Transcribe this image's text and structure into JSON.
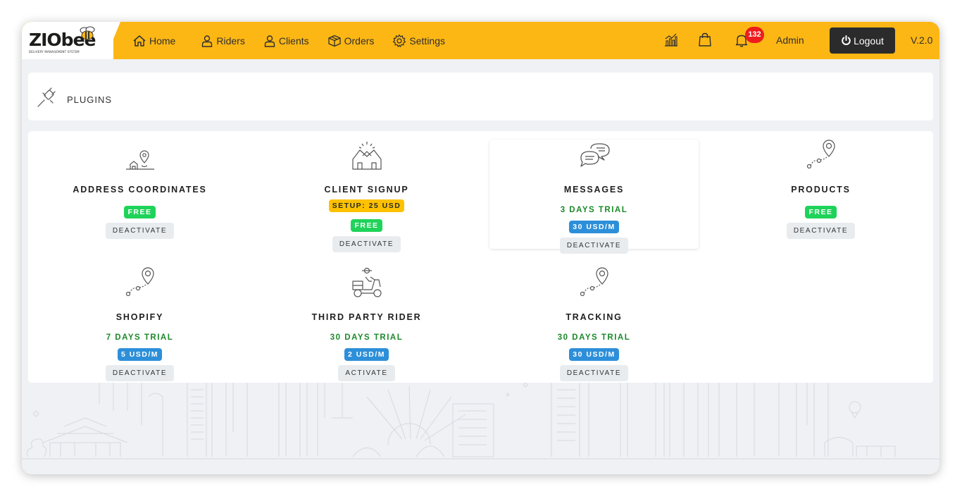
{
  "brand": {
    "name": "ZIObee",
    "tagline": "DELIVERY MANAGEMENT SYSTEM"
  },
  "nav": [
    {
      "label": "Home",
      "icon": "home-icon"
    },
    {
      "label": "Riders",
      "icon": "user-icon"
    },
    {
      "label": "Clients",
      "icon": "user-icon"
    },
    {
      "label": "Orders",
      "icon": "box-icon"
    },
    {
      "label": "Settings",
      "icon": "gear-icon"
    }
  ],
  "topbar": {
    "notification_count": "132",
    "user": "Admin",
    "logout_label": "Logout",
    "version": "V.2.0"
  },
  "page": {
    "title": "PLUGINS"
  },
  "plugins": [
    {
      "name": "ADDRESS COORDINATES",
      "icon": "address-pin-icon",
      "price": "FREE",
      "action": "DEACTIVATE"
    },
    {
      "name": "CLIENT SIGNUP",
      "icon": "handshake-icon",
      "setup": "SETUP: 25 USD",
      "price": "FREE",
      "action": "DEACTIVATE"
    },
    {
      "name": "MESSAGES",
      "icon": "chat-bubbles-icon",
      "trial": "3 DAYS TRIAL",
      "price": "30 USD/M",
      "action": "DEACTIVATE"
    },
    {
      "name": "PRODUCTS",
      "icon": "route-pin-icon",
      "price": "FREE",
      "action": "DEACTIVATE"
    },
    {
      "name": "SHOPIFY",
      "icon": "route-pin-icon",
      "trial": "7 DAYS TRIAL",
      "price": "5 USD/M",
      "action": "DEACTIVATE"
    },
    {
      "name": "THIRD PARTY RIDER",
      "icon": "scooter-icon",
      "trial": "30 DAYS TRIAL",
      "price": "2 USD/M",
      "action": "ACTIVATE"
    },
    {
      "name": "TRACKING",
      "icon": "route-pin-icon",
      "trial": "30 DAYS TRIAL",
      "price": "30 USD/M",
      "action": "DEACTIVATE"
    }
  ],
  "colors": {
    "topbar": "#fdb714",
    "free": "#1fd35a",
    "setup": "#fdc100",
    "price": "#2d8fd9",
    "trial": "#1b8a2a",
    "badge": "#ee1c1c"
  }
}
